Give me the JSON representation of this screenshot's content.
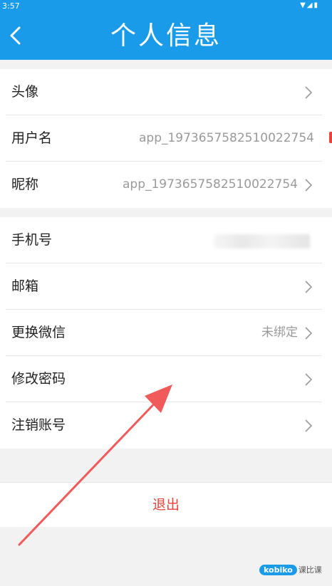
{
  "status_bar": {
    "time": "3:57",
    "icons": [
      "wifi-icon",
      "signal-icon",
      "battery-icon"
    ]
  },
  "header": {
    "title": "个人信息"
  },
  "groups": [
    {
      "items": [
        {
          "label": "头像",
          "value": "",
          "arrow": true
        },
        {
          "label": "用户名",
          "value": "app_1973657582510022754",
          "arrow": false
        },
        {
          "label": "昵称",
          "value": "app_1973657582510022754",
          "arrow": true
        }
      ]
    },
    {
      "items": [
        {
          "label": "手机号",
          "value": "",
          "arrow": true,
          "blurred": true
        },
        {
          "label": "邮箱",
          "value": "",
          "arrow": true
        },
        {
          "label": "更换微信",
          "value": "未绑定",
          "arrow": true
        },
        {
          "label": "修改密码",
          "value": "",
          "arrow": true
        },
        {
          "label": "注销账号",
          "value": "",
          "arrow": true
        }
      ]
    }
  ],
  "logout": {
    "label": "退出"
  },
  "annotation": {
    "color": "#f05a5a"
  },
  "watermark": {
    "brand": "kobiko",
    "text": "课比课"
  },
  "colors": {
    "primary": "#1a9bea",
    "danger": "#e8433c"
  }
}
